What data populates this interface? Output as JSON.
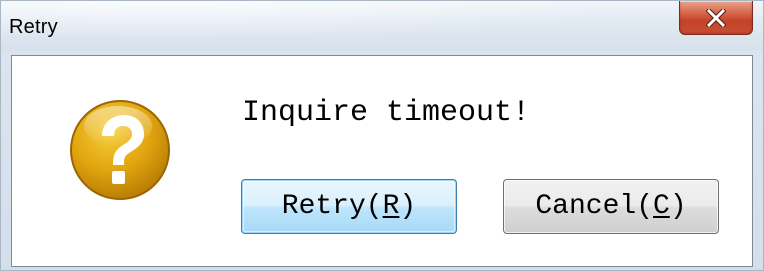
{
  "window": {
    "title": "Retry",
    "close_icon": "close-icon"
  },
  "dialog": {
    "icon": "question-icon",
    "icon_color": "#E1A50F",
    "message": "Inquire timeout!"
  },
  "buttons": {
    "retry": {
      "text": "Retry",
      "open": "(",
      "mnemonic": "R",
      "close": ")"
    },
    "cancel": {
      "text": "Cancel",
      "open": "(",
      "mnemonic": "C",
      "close": ")"
    }
  }
}
